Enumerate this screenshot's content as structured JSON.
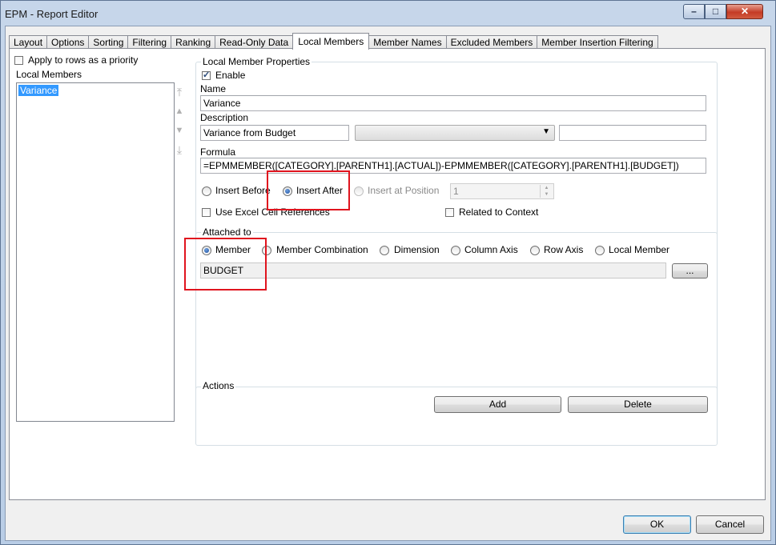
{
  "window": {
    "title": "EPM - Report Editor",
    "controls": {
      "minimize": "–",
      "maximize": "□",
      "close": "✕"
    }
  },
  "tabs": [
    {
      "label": "Layout"
    },
    {
      "label": "Options"
    },
    {
      "label": "Sorting"
    },
    {
      "label": "Filtering"
    },
    {
      "label": "Ranking"
    },
    {
      "label": "Read-Only Data"
    },
    {
      "label": "Local Members",
      "active": true
    },
    {
      "label": "Member Names"
    },
    {
      "label": "Excluded Members"
    },
    {
      "label": "Member Insertion Filtering"
    }
  ],
  "left": {
    "apply_priority_label": "Apply to rows as a priority",
    "apply_priority_checked": false,
    "local_members_label": "Local Members",
    "items": [
      "Variance"
    ],
    "move_icons": [
      "move-top-icon",
      "move-up-icon",
      "move-down-icon",
      "move-bottom-icon"
    ]
  },
  "properties": {
    "group_title": "Local Member Properties",
    "enable_label": "Enable",
    "enable_checked": true,
    "name_label": "Name",
    "name_value": "Variance",
    "description_label": "Description",
    "description_value": "Variance from Budget",
    "description_combo_value": "",
    "description_extra_value": "",
    "formula_label": "Formula",
    "formula_value": "=EPMMEMBER([CATEGORY].[PARENTH1].[ACTUAL])-EPMMEMBER([CATEGORY].[PARENTH1].[BUDGET])",
    "insert_before_label": "Insert Before",
    "insert_after_label": "Insert After",
    "insert_position_label": "Insert at Position",
    "insert_selected": "Insert After",
    "position_value": "1",
    "use_excel_refs_label": "Use Excel Cell References",
    "use_excel_refs_checked": false,
    "related_context_label": "Related to Context",
    "related_context_checked": false
  },
  "attached": {
    "group_title": "Attached to",
    "options": [
      "Member",
      "Member Combination",
      "Dimension",
      "Column Axis",
      "Row Axis",
      "Local Member"
    ],
    "selected": "Member",
    "value": "BUDGET",
    "browse_label": "..."
  },
  "actions": {
    "group_title": "Actions",
    "add_label": "Add",
    "delete_label": "Delete"
  },
  "footer": {
    "ok_label": "OK",
    "cancel_label": "Cancel"
  },
  "colors": {
    "highlight": "#e0141e",
    "selection": "#3399ff"
  }
}
